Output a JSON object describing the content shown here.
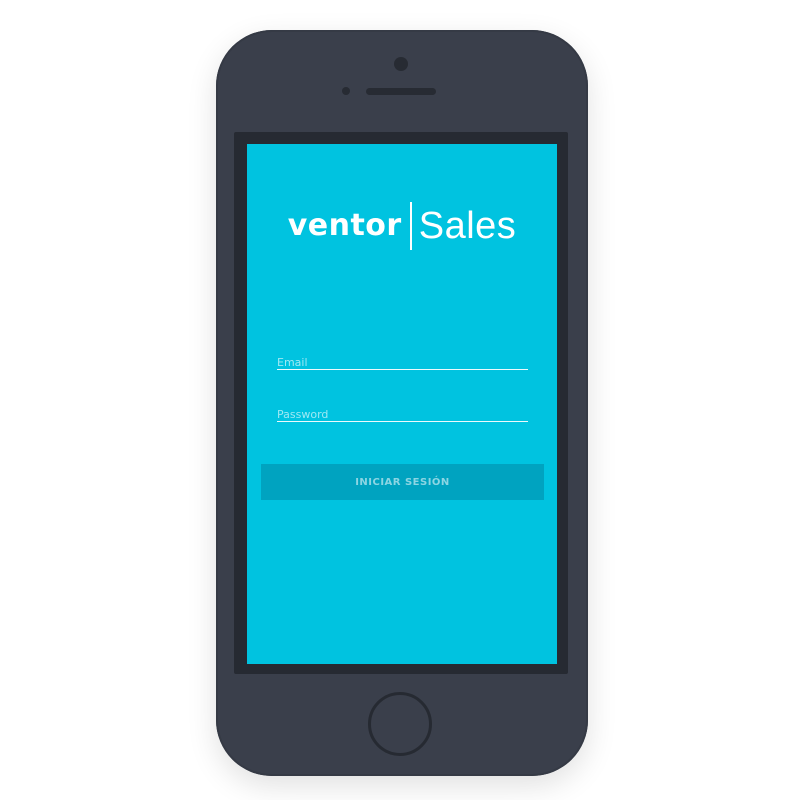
{
  "app": {
    "logo_ventor": "ventor",
    "logo_sales": "Sales"
  },
  "login": {
    "email_placeholder": "Email",
    "email_value": "",
    "password_placeholder": "Password",
    "password_value": "",
    "submit_label": "INICIAR SESIÓN"
  },
  "colors": {
    "screen_background": "#00c3e0",
    "button_background": "#00a3c0",
    "device_body": "#3a3f4b",
    "device_bezel": "#262a32"
  },
  "icons": [
    "camera-icon",
    "speaker-icon",
    "home-button-icon"
  ]
}
